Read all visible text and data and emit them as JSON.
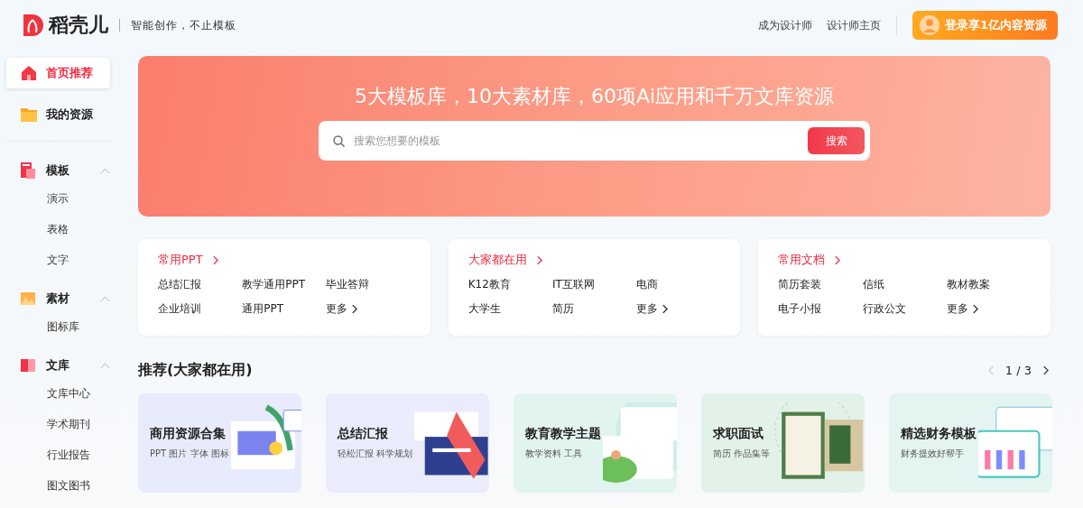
{
  "header": {
    "brand": "稻壳儿",
    "slogan": "智能创作，不止模板",
    "links": [
      "成为设计师",
      "设计师主页"
    ],
    "login_button": "登录享1亿内容资源"
  },
  "sidebar": {
    "top_items": [
      {
        "label": "首页推荐",
        "kind": "home",
        "selected": true
      },
      {
        "label": "我的资源",
        "kind": "folder",
        "selected": false
      }
    ],
    "groups": [
      {
        "label": "模板",
        "kind": "template",
        "expanded": true,
        "items": [
          "演示",
          "表格",
          "文字"
        ]
      },
      {
        "label": "素材",
        "kind": "material",
        "expanded": true,
        "items": [
          "图标库"
        ]
      },
      {
        "label": "文库",
        "kind": "library",
        "expanded": true,
        "items": [
          "文库中心",
          "学术期刊",
          "行业报告",
          "图文图书"
        ]
      }
    ]
  },
  "banner": {
    "headline": "5大模板库，10大素材库，60项Ai应用和千万文库资源",
    "search": {
      "placeholder": "搜索您想要的模板",
      "button": "搜索"
    }
  },
  "categories": [
    {
      "title": "常用PPT",
      "links": [
        "总结汇报",
        "教学通用PPT",
        "毕业答辩",
        "企业培训",
        "通用PPT"
      ],
      "more": "更多"
    },
    {
      "title": "大家都在用",
      "links": [
        "K12教育",
        "IT互联网",
        "电商",
        "大学生",
        "简历"
      ],
      "more": "更多"
    },
    {
      "title": "常用文档",
      "links": [
        "简历套装",
        "信纸",
        "教材教案",
        "电子小报",
        "行政公文"
      ],
      "more": "更多"
    }
  ],
  "recommend": {
    "title": "推荐(大家都在用)",
    "pager": {
      "text": "1 / 3",
      "prev_disabled": true,
      "next_disabled": false
    },
    "cards": [
      {
        "title": "商用资源合集",
        "subtitle": "PPT 图片 字体 图标",
        "color": "#e8ebfb",
        "kind": "picture"
      },
      {
        "title": "总结汇报",
        "subtitle": "轻松汇报 科学规划",
        "color": "#eaecfc",
        "kind": "picture"
      },
      {
        "title": "教育教学主题",
        "subtitle": "教学资料 工具",
        "color": "#e2f4f0",
        "kind": "picture"
      },
      {
        "title": "求职面试",
        "subtitle": "简历 作品集等",
        "color": "#e3f2e9",
        "kind": "picture"
      },
      {
        "title": "精选财务模板",
        "subtitle": "财务提效好帮手",
        "color": "#e4f4f1",
        "kind": "picture"
      }
    ]
  }
}
